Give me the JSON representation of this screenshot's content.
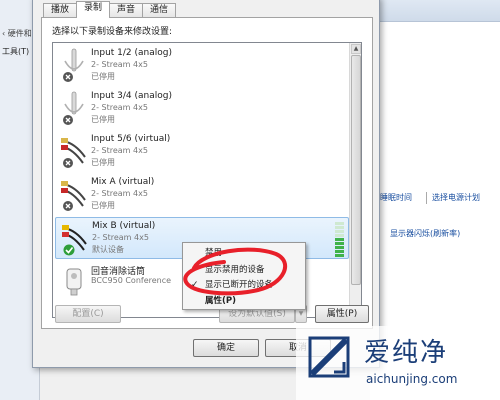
{
  "background_window": {
    "breadcrumb": "硬件和",
    "menu_tools": "工具(T)",
    "links": [
      "睡眠时间",
      "选择电源计划",
      "显示器闪烁(刷新率)"
    ]
  },
  "dialog": {
    "tabs": [
      {
        "label": "播放",
        "active": false
      },
      {
        "label": "录制",
        "active": true
      },
      {
        "label": "声音",
        "active": false
      },
      {
        "label": "通信",
        "active": false
      }
    ],
    "instruction": "选择以下录制设备来修改设置:",
    "devices": [
      {
        "name": "Input 1/2 (analog)",
        "desc": "2- Stream 4x5",
        "status": "已停用",
        "icon": "microphone-icon",
        "disabled": true
      },
      {
        "name": "Input 3/4 (analog)",
        "desc": "2- Stream 4x5",
        "status": "已停用",
        "icon": "microphone-icon",
        "disabled": true
      },
      {
        "name": "Input 5/6 (virtual)",
        "desc": "2- Stream 4x5",
        "status": "已停用",
        "icon": "rca-cable-icon",
        "disabled": true
      },
      {
        "name": "Mix A (virtual)",
        "desc": "2- Stream 4x5",
        "status": "已停用",
        "icon": "rca-cable-icon",
        "disabled": true
      },
      {
        "name": "Mix B (virtual)",
        "desc": "2- Stream 4x5",
        "status": "默认设备",
        "icon": "rca-cable-icon",
        "disabled": false,
        "selected": true,
        "default": true
      },
      {
        "name": "回音消除话筒",
        "desc": "BCC950 Conference",
        "status": "",
        "icon": "webcam-mic-icon",
        "disabled": false
      }
    ],
    "buttons": {
      "configure": "配置(C)",
      "set_default": "设为默认值(S)",
      "properties": "属性(P)",
      "ok": "确定",
      "cancel": "取消"
    }
  },
  "context_menu": {
    "items": [
      {
        "label": "禁用",
        "checked": false,
        "bold": false
      },
      {
        "label": "显示禁用的设备",
        "checked": true,
        "bold": false
      },
      {
        "label": "显示已断开的设备",
        "checked": true,
        "bold": false
      },
      {
        "label": "属性(P)",
        "checked": false,
        "bold": true
      }
    ]
  },
  "watermark": {
    "brand_cn": "爱纯净",
    "url": "aichunjing.com"
  },
  "colors": {
    "annotation_red": "#e8202a",
    "level_green": "#3fb24a",
    "selection_blue": "#d3e8fb",
    "watermark_blue": "#1b3e78"
  }
}
